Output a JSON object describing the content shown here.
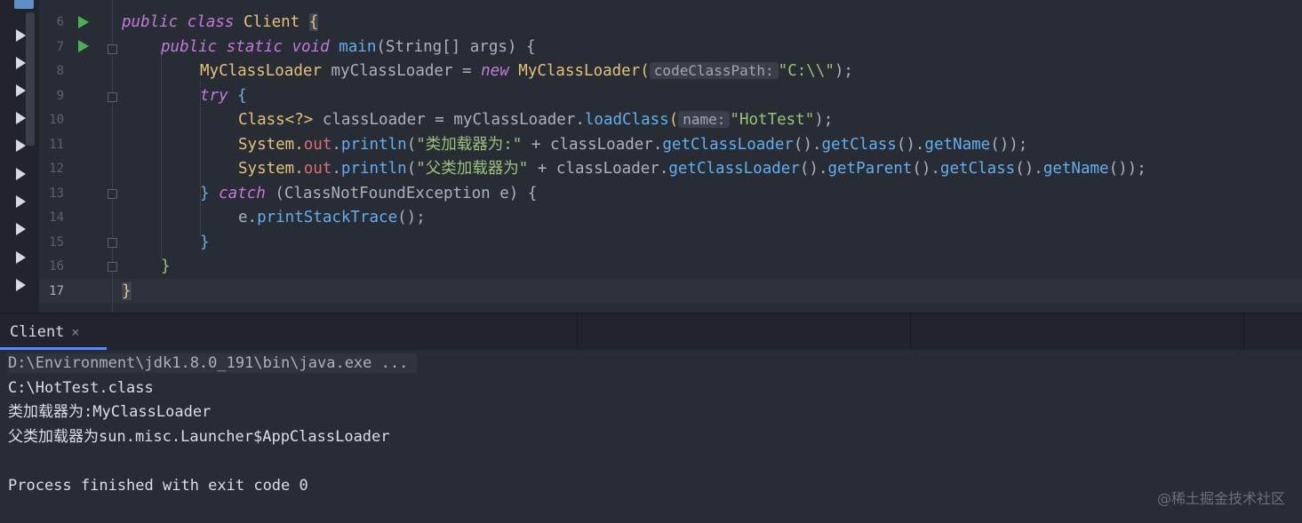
{
  "editor": {
    "line_numbers": [
      "6",
      "7",
      "8",
      "9",
      "10",
      "11",
      "12",
      "13",
      "14",
      "15",
      "16",
      "17"
    ],
    "code": {
      "l6": {
        "kw1": "public",
        "kw2": "class",
        "name": "Client",
        "brace": "{"
      },
      "l7": {
        "kw1": "public",
        "kw2": "static",
        "kw3": "void",
        "fn": "main",
        "params": "(String[] args) {"
      },
      "l8": {
        "type": "MyClassLoader",
        "var": "myClassLoader",
        "eq": "=",
        "kw": "new",
        "ctor": "MyClassLoader(",
        "hint": "codeClassPath:",
        "arg": "\"C:\\\\\"",
        "end": ");"
      },
      "l9": {
        "kw": "try",
        "brace": "{"
      },
      "l10": {
        "type": "Class<?>",
        "var": "classLoader",
        "eq": "= myClassLoader.",
        "fn": "loadClass",
        "open": "(",
        "hint": "name:",
        "arg": "\"HotTest\"",
        "end": ");"
      },
      "l11": {
        "sys": "System.",
        "out": "out",
        "dot": ".",
        "fn": "println",
        "open": "(",
        "str": "\"类加载器为:\"",
        "plus": " + classLoader.",
        "c1": "getClassLoader",
        "p1": "().",
        "c2": "getClass",
        "p2": "().",
        "c3": "getName",
        "end": "());"
      },
      "l12": {
        "sys": "System.",
        "out": "out",
        "dot": ".",
        "fn": "println",
        "open": "(",
        "str": "\"父类加载器为\"",
        "plus": " + classLoader.",
        "c1": "getClassLoader",
        "p1": "().",
        "c2": "getParent",
        "p2": "().",
        "c3": "getClass",
        "p3": "().",
        "c4": "getName",
        "end": "());"
      },
      "l13": {
        "close": "}",
        "kw": "catch",
        "params": "(ClassNotFoundException",
        "var": "e",
        "end": ") {"
      },
      "l14": {
        "obj": "e.",
        "fn": "printStackTrace",
        "end": "();"
      },
      "l15": {
        "brace": "}"
      },
      "l16": {
        "brace": "}"
      },
      "l17": {
        "brace": "}"
      }
    }
  },
  "run_panel": {
    "tab_label": "Client",
    "close_glyph": "×"
  },
  "console": {
    "command": "D:\\Environment\\jdk1.8.0_191\\bin\\java.exe ...",
    "lines": [
      "C:\\HotTest.class",
      "类加载器为:MyClassLoader",
      "父类加载器为sun.misc.Launcher$AppClassLoader",
      "Process finished with exit code 0"
    ]
  },
  "watermark": "@稀土掘金技术社区",
  "colors": {
    "background": "#282c34",
    "keyword": "#c678dd",
    "type": "#e5c07b",
    "function": "#61afef",
    "string": "#98c379",
    "variable": "#e06c75",
    "run_icon": "#4caf50",
    "tab_accent": "#528bff"
  },
  "icons": {
    "run": "run-gutter-icon",
    "fold": "fold-marker-icon",
    "project_tool": "folder-icon",
    "strip_run": "play-icon"
  }
}
